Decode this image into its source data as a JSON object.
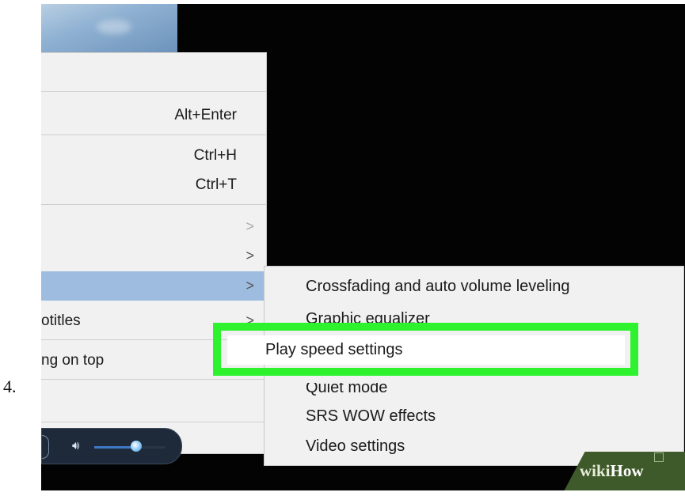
{
  "step_label": "4.",
  "context_menu": {
    "items": [
      {
        "label": "",
        "shortcut": "Alt+Enter",
        "submenu": false
      },
      {
        "label": "",
        "shortcut": "Ctrl+H",
        "submenu": false
      },
      {
        "label": "",
        "shortcut": "Ctrl+T",
        "submenu": false
      },
      {
        "label": "",
        "shortcut": "",
        "submenu": true
      },
      {
        "label": "",
        "shortcut": "",
        "submenu": true
      },
      {
        "label": "",
        "shortcut": "",
        "submenu": true,
        "highlighted": true
      },
      {
        "label": "otitles",
        "shortcut": "",
        "submenu": true
      },
      {
        "label": "ng on top",
        "shortcut": "",
        "submenu": false
      }
    ],
    "chevron": ">"
  },
  "sub_menu": {
    "items": [
      "Crossfading and auto volume leveling",
      "Graphic equalizer",
      "Play speed settings",
      "Quiet mode",
      "SRS WOW effects",
      "Video settings"
    ],
    "selected_index": 2
  },
  "player_controls": {
    "volume_icon": "volume-icon",
    "volume_level": 0.6
  },
  "watermark": {
    "brand_wiki": "wiki",
    "brand_how": "How"
  },
  "colors": {
    "highlight_border": "#2ef22e",
    "menu_hover": "#9ebce0",
    "menu_bg": "#f1f1f1"
  }
}
